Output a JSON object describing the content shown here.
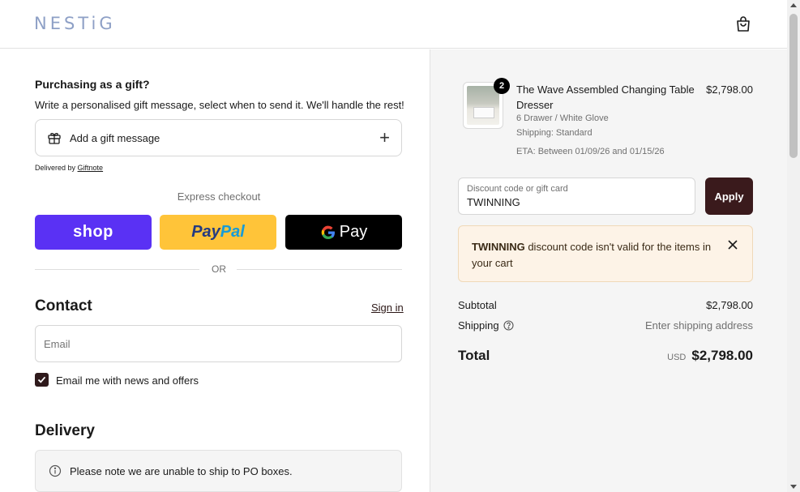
{
  "header": {
    "logo": "NESTiG",
    "cart_icon": "shopping-bag-icon"
  },
  "gift": {
    "title": "Purchasing as a gift?",
    "subtitle": "Write a personalised gift message, select when to send it. We'll handle the rest!",
    "add_label": "Add a gift message",
    "delivered_by": "Delivered by",
    "delivered_link": "Giftnote"
  },
  "express": {
    "label": "Express checkout",
    "shop_label": "shop",
    "paypal_part1": "Pay",
    "paypal_part2": "Pal",
    "gpay_g": "G",
    "gpay_label": "Pay",
    "or_label": "OR"
  },
  "contact": {
    "heading": "Contact",
    "sign_in": "Sign in",
    "email_placeholder": "Email",
    "newsletter_label": "Email me with news and offers",
    "newsletter_checked": true
  },
  "delivery": {
    "heading": "Delivery",
    "notice": "Please note we are unable to ship to PO boxes."
  },
  "order": {
    "product": {
      "name": "The Wave Assembled Changing Table Dresser",
      "variant": "6 Drawer / White Glove",
      "shipping": "Shipping: Standard",
      "eta": "ETA: Between 01/09/26 and 01/15/26",
      "price": "$2,798.00",
      "quantity": "2"
    },
    "discount": {
      "label": "Discount code or gift card",
      "value": "TWINNING",
      "apply_label": "Apply"
    },
    "error": {
      "code": "TWINNING",
      "message": " discount code isn't valid for the items in your cart"
    },
    "subtotal_label": "Subtotal",
    "subtotal_value": "$2,798.00",
    "shipping_label": "Shipping",
    "shipping_value": "Enter shipping address",
    "total_label": "Total",
    "total_currency": "USD",
    "total_value": "$2,798.00"
  },
  "colors": {
    "brand": "#8ea0c6",
    "shop_pay": "#5a31f4",
    "paypal": "#ffc439",
    "apply_button": "#3a1a1c",
    "error_bg": "#fdf3e7"
  }
}
